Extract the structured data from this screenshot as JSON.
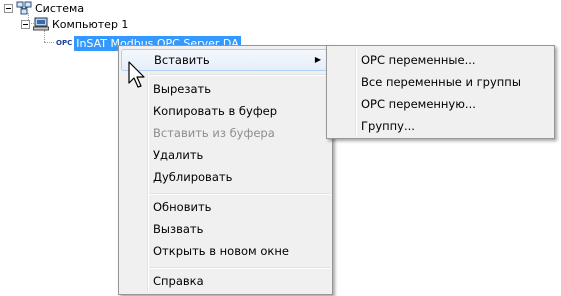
{
  "tree": {
    "root_label": "Система",
    "computer_label": "Компьютер 1",
    "opc_icon_text": "OPC",
    "server_label": "InSAT Modbus OPC Server DA"
  },
  "context_menu": {
    "insert": "Вставить",
    "cut": "Вырезать",
    "copy": "Копировать в буфер",
    "paste": "Вставить из буфера",
    "delete": "Удалить",
    "duplicate": "Дублировать",
    "refresh": "Обновить",
    "call": "Вызвать",
    "open_new_window": "Открыть в новом окне",
    "help": "Справка"
  },
  "submenu": {
    "opc_variables": "OPC переменные...",
    "all_variables_groups": "Все переменные и группы",
    "opc_variable": "OPC переменную...",
    "group": "Группу..."
  }
}
